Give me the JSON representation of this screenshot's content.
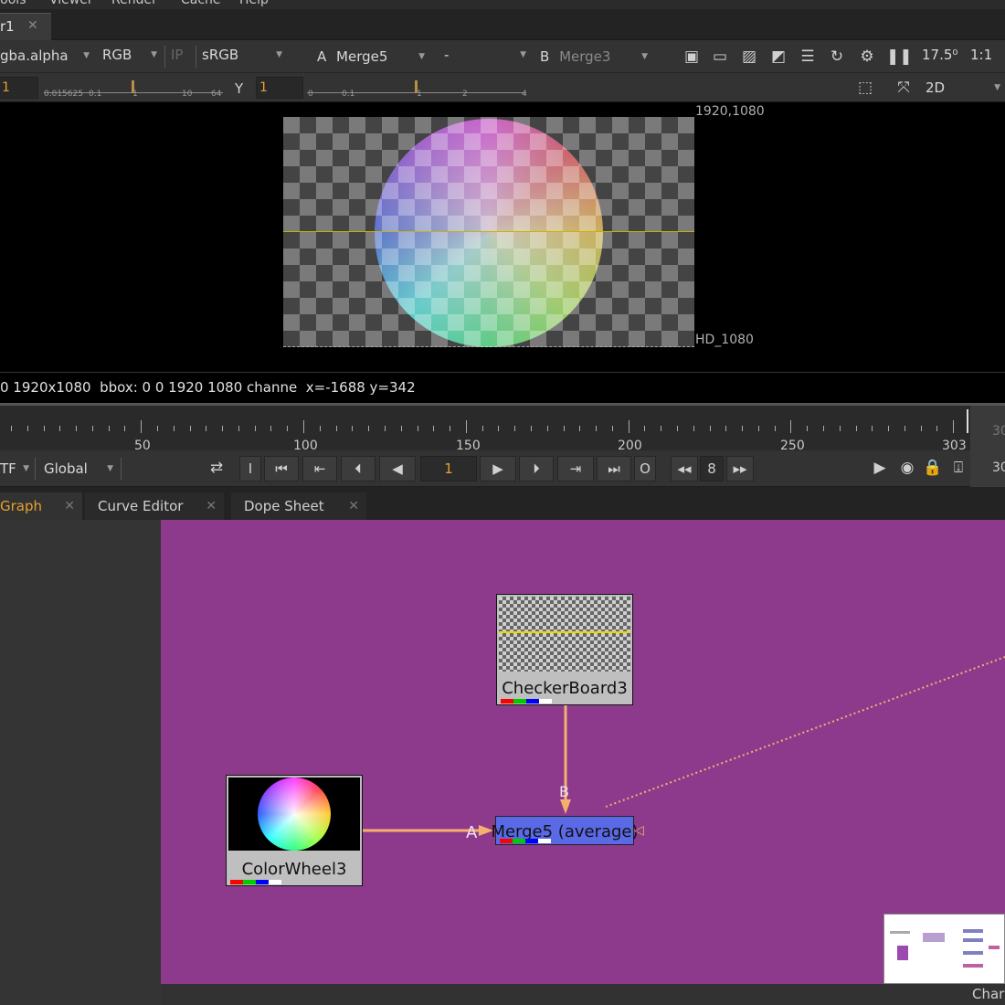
{
  "menu": [
    "Tools",
    "Viewer",
    "Render",
    "Cache",
    "Help"
  ],
  "viewer_tab": {
    "label": "r1",
    "close": "✕"
  },
  "toolbar1": {
    "channel": "gba.alpha",
    "display": "RGB",
    "ip": "IP",
    "colorspace": "sRGB",
    "input_a_letter": "A",
    "input_a": "Merge5",
    "composite": "-",
    "input_b_letter": "B",
    "input_b": "Merge3",
    "zoom": "17.5⁰",
    "ratio": "1:1"
  },
  "toolbar2": {
    "gain_value": "1",
    "gain_ticks": [
      "0.015625",
      "0.1",
      "1",
      "10",
      "64"
    ],
    "gamma_label": "Y",
    "gamma_value": "1",
    "gamma_ticks": [
      "0",
      "0.1",
      "1",
      "2",
      "4"
    ],
    "view_mode": "2D"
  },
  "viewer": {
    "format_top": "1920,1080",
    "format_name": "HD_1080"
  },
  "info": "0 1920x1080  bbox: 0 0 1920 1080 channe  x=-1688 y=342",
  "timeline": {
    "labels": [
      "50",
      "100",
      "150",
      "200",
      "250",
      "303"
    ],
    "right_value": "30"
  },
  "transport": {
    "tf": "TF",
    "scope": "Global",
    "frame": "1",
    "step": "8",
    "in_btn": "I",
    "out_btn": "O",
    "right_value": "30"
  },
  "graph_tabs": [
    {
      "label": "Graph"
    },
    {
      "label": "Curve Editor"
    },
    {
      "label": "Dope Sheet"
    }
  ],
  "nodes": {
    "checker": "CheckerBoard3",
    "wheel": "ColorWheel3",
    "merge": "Merge5 (average)",
    "merge_input_a": "A",
    "merge_input_b": "B"
  },
  "bottom_right": "Char",
  "colors": {
    "graph_bg": "#8e3a8c",
    "merge_node": "#5a6ae6",
    "pipe": "#f5b070",
    "accent": "#e8a030"
  }
}
